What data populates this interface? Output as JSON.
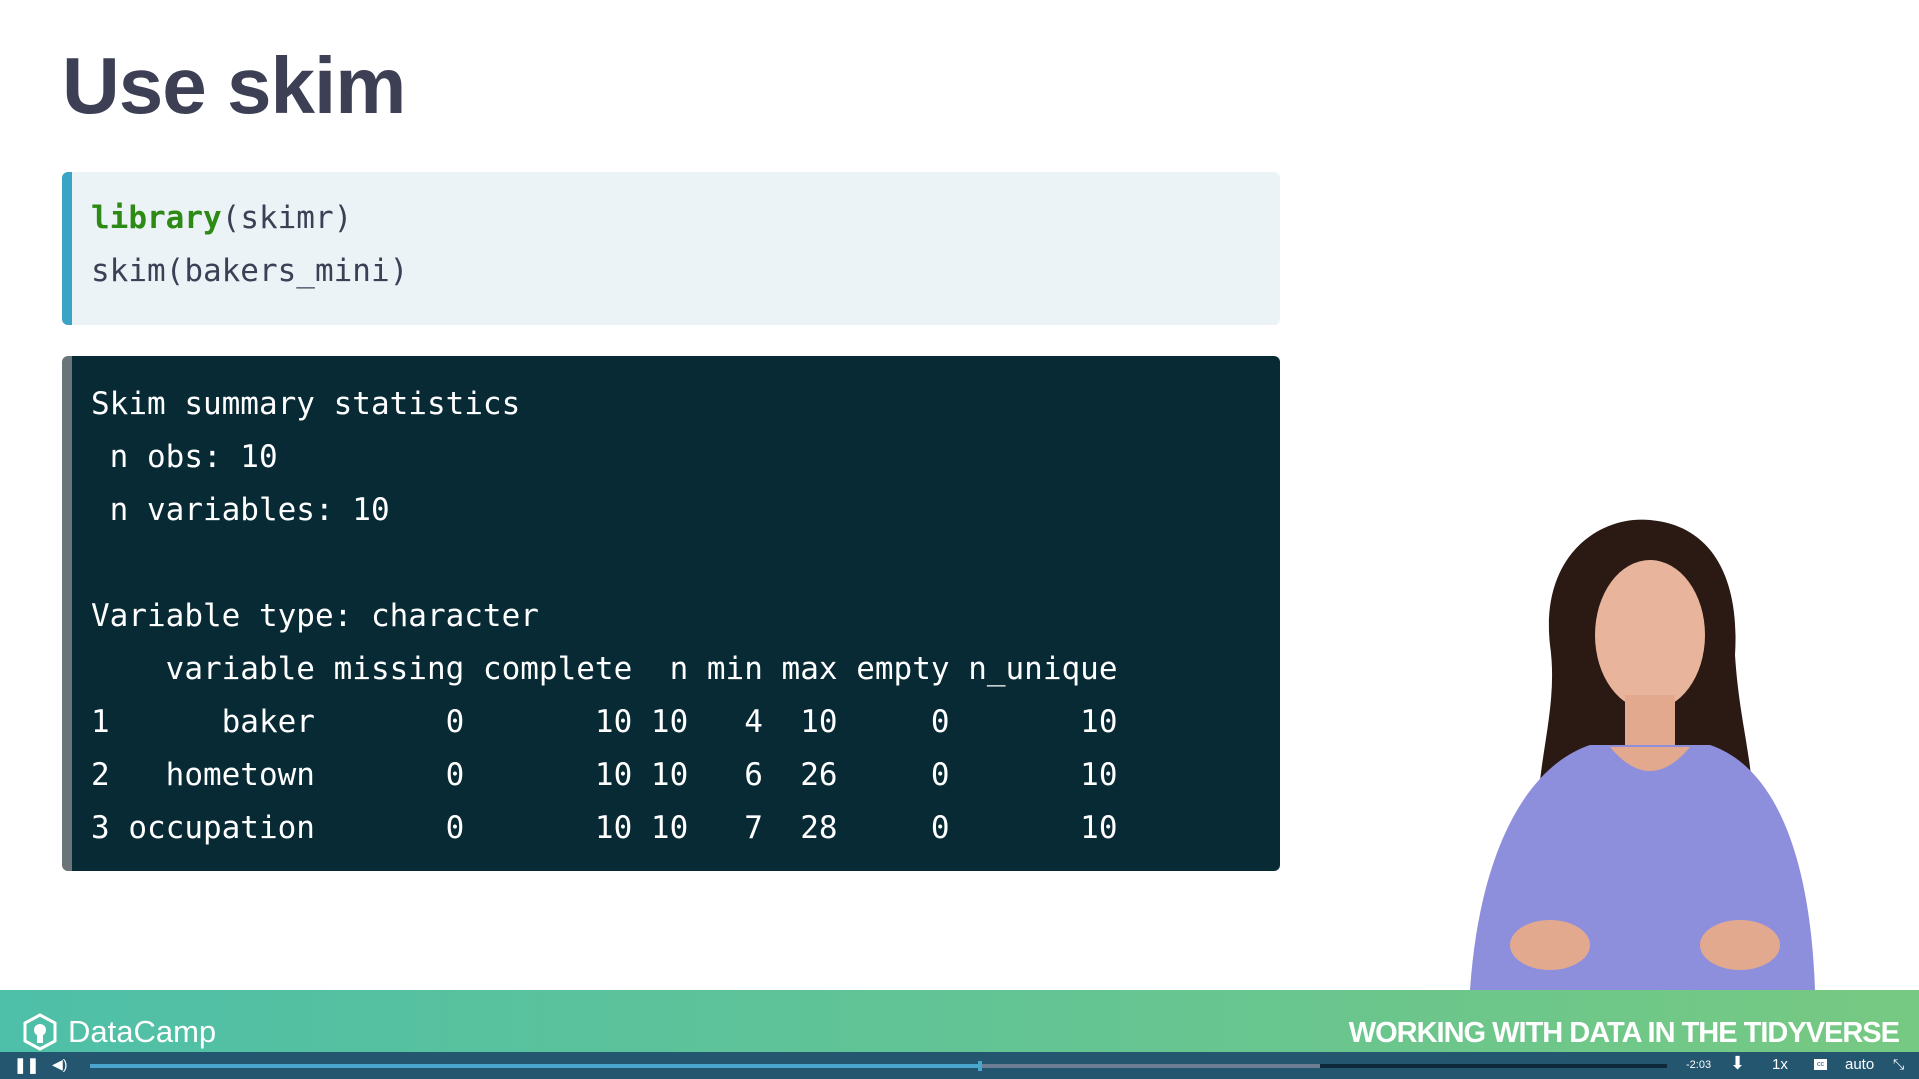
{
  "slide": {
    "title": "Use skim",
    "code_lines": [
      {
        "keyword": "library",
        "rest": "(skimr)"
      },
      {
        "keyword": "",
        "rest": "skim(bakers_mini)"
      }
    ],
    "output_lines": [
      "Skim summary statistics",
      " n obs: 10",
      " n variables: 10",
      "",
      "Variable type: character",
      "    variable missing complete  n min max empty n_unique",
      "1      baker       0       10 10   4  10     0       10",
      "2   hometown       0       10 10   6  26     0       10",
      "3 occupation       0       10 10   7  28     0       10"
    ]
  },
  "footer": {
    "brand": "DataCamp",
    "course": "WORKING WITH DATA IN THE TIDYVERSE"
  },
  "player": {
    "time_remaining": "-2:03",
    "speed": "1x",
    "quality": "auto",
    "progress_percent": 56.3,
    "buffered_percent": 78,
    "icons": [
      "pause-icon",
      "volume-icon",
      "download-icon",
      "captions-icon",
      "exit-fullscreen-icon"
    ]
  }
}
